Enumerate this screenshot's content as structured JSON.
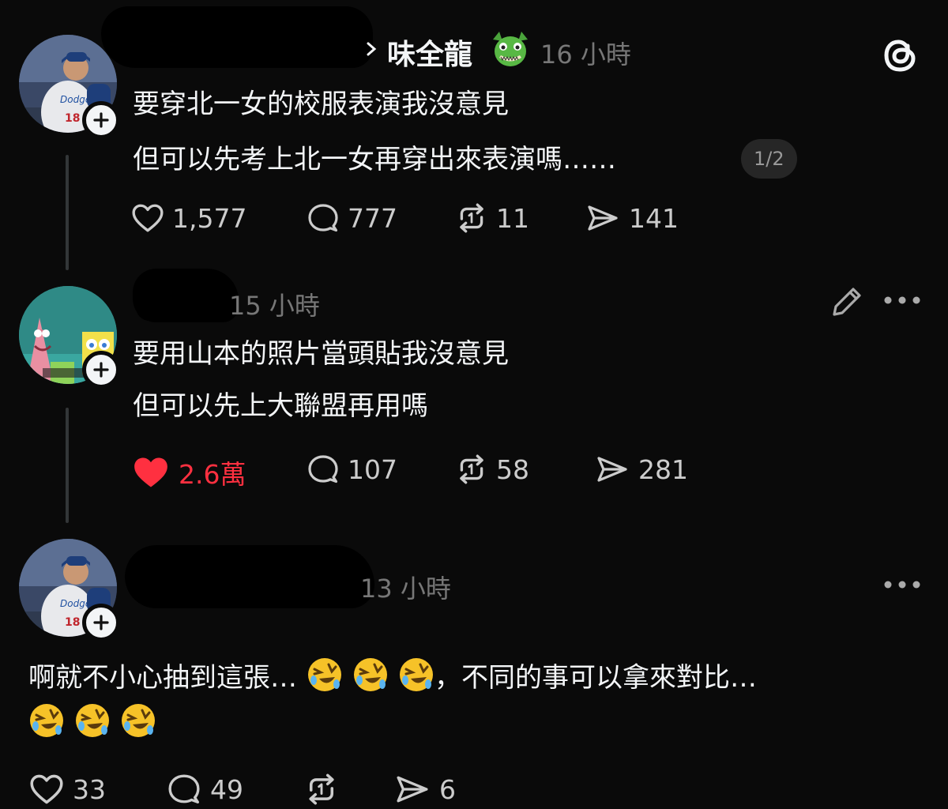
{
  "post1": {
    "username": "味全龍",
    "time": "16 小時",
    "line1": "要穿北一女的校服表演我沒意見",
    "line2": "但可以先考上北一女再穿出來表演嗎……",
    "page_indicator": "1/2",
    "likes": "1,577",
    "replies": "777",
    "reposts": "11",
    "shares": "141"
  },
  "post2": {
    "time": "15 小時",
    "line1": "要用山本的照片當頭貼我沒意見",
    "line2": "但可以先上大聯盟再用嗎",
    "likes": "2.6萬",
    "replies": "107",
    "reposts": "58",
    "shares": "281"
  },
  "post3": {
    "time": "13 小時",
    "line1_a": "啊就不小心抽到這張…",
    "line1_b": "，不同的事可以拿來對比…",
    "likes": "33",
    "replies": "49",
    "shares": "6"
  },
  "colors": {
    "background": "#0a0a0a",
    "liked": "#ff3040",
    "muted": "#777777"
  },
  "icons": [
    "threads-logo-icon",
    "dragon-emoji-icon",
    "heart-icon",
    "comment-icon",
    "repost-icon",
    "share-icon",
    "edit-icon",
    "more-icon",
    "rofl-emoji-icon",
    "plus-icon"
  ]
}
